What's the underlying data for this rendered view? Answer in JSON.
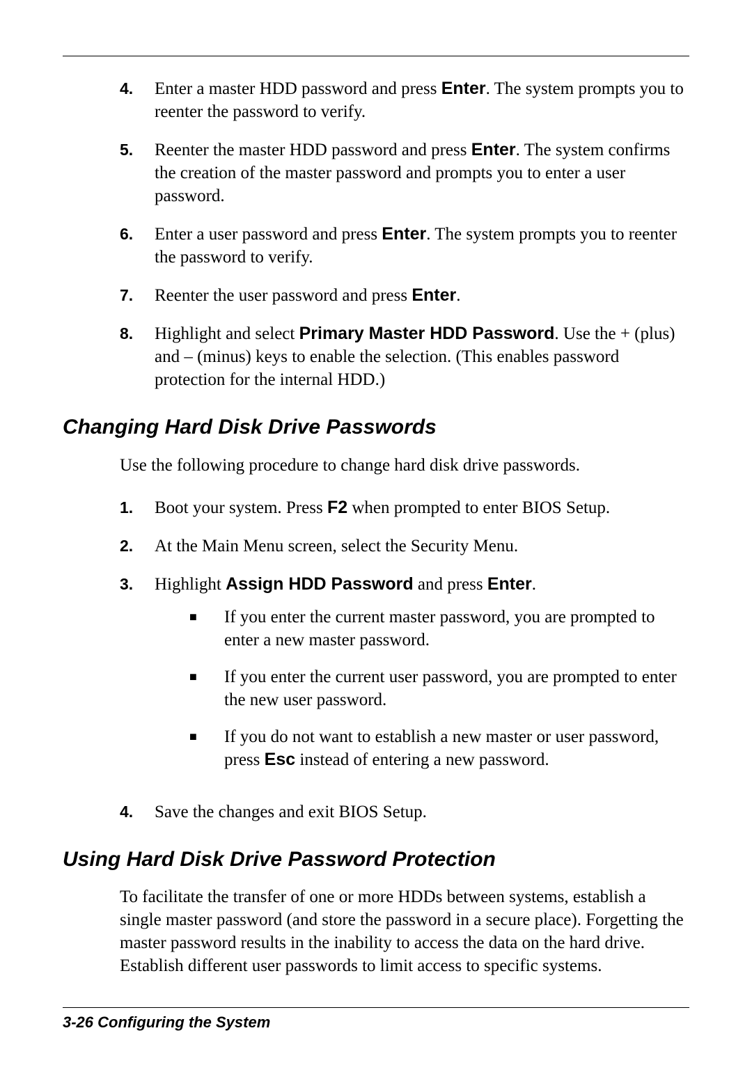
{
  "steps_a": [
    {
      "n": "4.",
      "pre": "Enter a master HDD password and press ",
      "b1": "Enter",
      "post": ". The system prompts you to reenter the password to verify."
    },
    {
      "n": "5.",
      "pre": "Reenter the master HDD password and press ",
      "b1": "Enter",
      "post": ". The system confirms the creation of the master password and prompts you to enter a user password."
    },
    {
      "n": "6.",
      "pre": "Enter a user password and press ",
      "b1": "Enter",
      "post": ". The system prompts you to reenter the password to verify."
    },
    {
      "n": "7.",
      "pre": "Reenter the user password and press ",
      "b1": "Enter",
      "post": "."
    },
    {
      "n": "8.",
      "pre": "Highlight and select ",
      "b1": "Primary Master HDD Password",
      "post": ". Use the + (plus) and – (minus) keys to enable the selection. (This enables password protection for the internal HDD.)"
    }
  ],
  "h2_a": "Changing Hard Disk Drive Passwords",
  "para_a": "Use the following procedure to change hard disk drive passwords.",
  "steps_b": {
    "s1": {
      "n": "1.",
      "pre": "Boot your system. Press ",
      "b1": "F2",
      "post": " when prompted to enter BIOS Setup."
    },
    "s2": {
      "n": "2.",
      "txt": "At the Main Menu screen, select the Security Menu."
    },
    "s3": {
      "n": "3.",
      "pre": "Highlight ",
      "b1": "Assign HDD Password",
      "mid": " and press ",
      "b2": "Enter",
      "post": "."
    },
    "s4": {
      "n": "4.",
      "txt": "Save the changes and exit BIOS Setup."
    }
  },
  "bullets": {
    "b1": "If you enter the current master password, you are prompted to enter a new master password.",
    "b2": "If you enter the current user password, you are prompted to enter the new user password.",
    "b3_pre": "If you do not want to establish a new master or user password, press ",
    "b3_bold": "Esc",
    "b3_post": " instead of entering a new password."
  },
  "h2_b": "Using Hard Disk Drive Password Protection",
  "para_b": "To facilitate the transfer of one or more HDDs between systems, establish a single master password (and store the password in a secure place). Forgetting the master password results in the inability to access the data on the hard drive. Establish different user passwords to limit access to specific systems.",
  "footer": "3-26   Configuring the System",
  "square": "■"
}
